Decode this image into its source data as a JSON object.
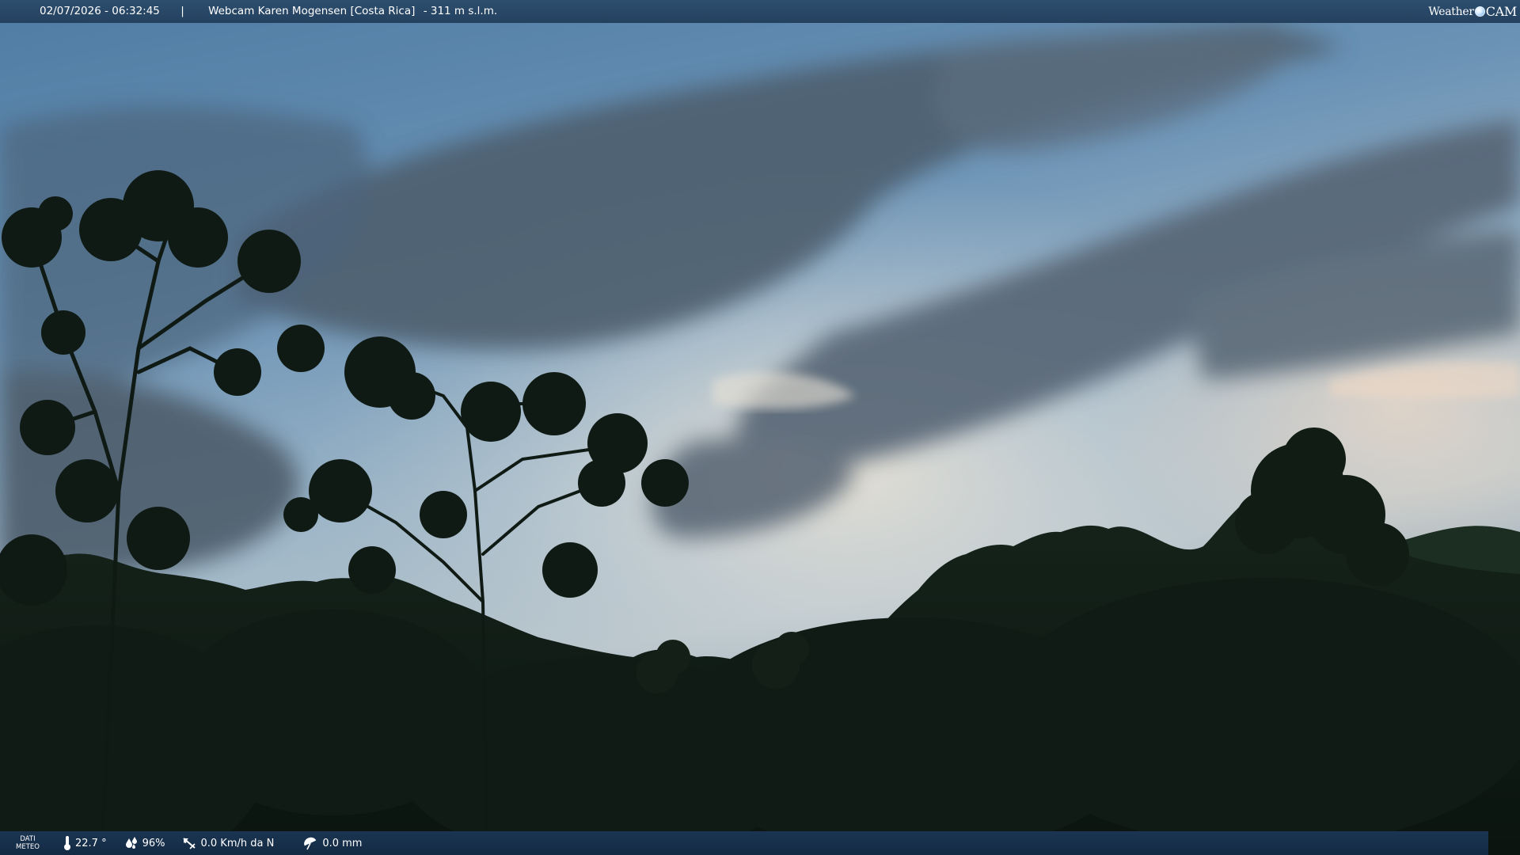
{
  "overlay": {
    "datetime": "02/07/2026 - 06:32:45",
    "separator": "|",
    "camera_name": "Webcam Karen Mogensen [Costa Rica]",
    "altitude": "- 311 m s.l.m."
  },
  "logo": {
    "weather": "Weather",
    "cam": "CAM"
  },
  "weather_data": {
    "label_line1": "DATI",
    "label_line2": "METEO",
    "temperature": "22.7 °",
    "humidity": "96%",
    "wind": "0.0 Km/h da N",
    "rain": "0.0 mm"
  },
  "icons": {
    "temperature": "thermometer-icon",
    "humidity": "humidity-drops-icon",
    "wind": "wind-direction-icon",
    "rain": "rain-umbrella-icon"
  },
  "colors": {
    "overlay_bar": "#24415f",
    "data_bar": "#142a43",
    "text": "#ffffff"
  }
}
